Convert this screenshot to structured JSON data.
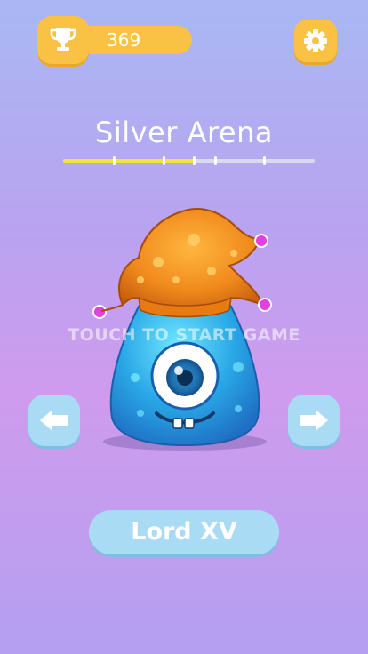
{
  "header": {
    "score": "369",
    "trophy_icon": "trophy-icon",
    "settings_icon": "gear-icon",
    "accent_color": "#f9c244"
  },
  "arena": {
    "title": "Silver Arena",
    "progress": 0.52,
    "progress_color": "#f6e23c"
  },
  "game": {
    "start_prompt": "TOUCH TO START GAME",
    "character_name": "Lord XV",
    "prev_icon": "arrow-left-icon",
    "next_icon": "arrow-right-icon",
    "button_color": "#a9dcf4"
  }
}
